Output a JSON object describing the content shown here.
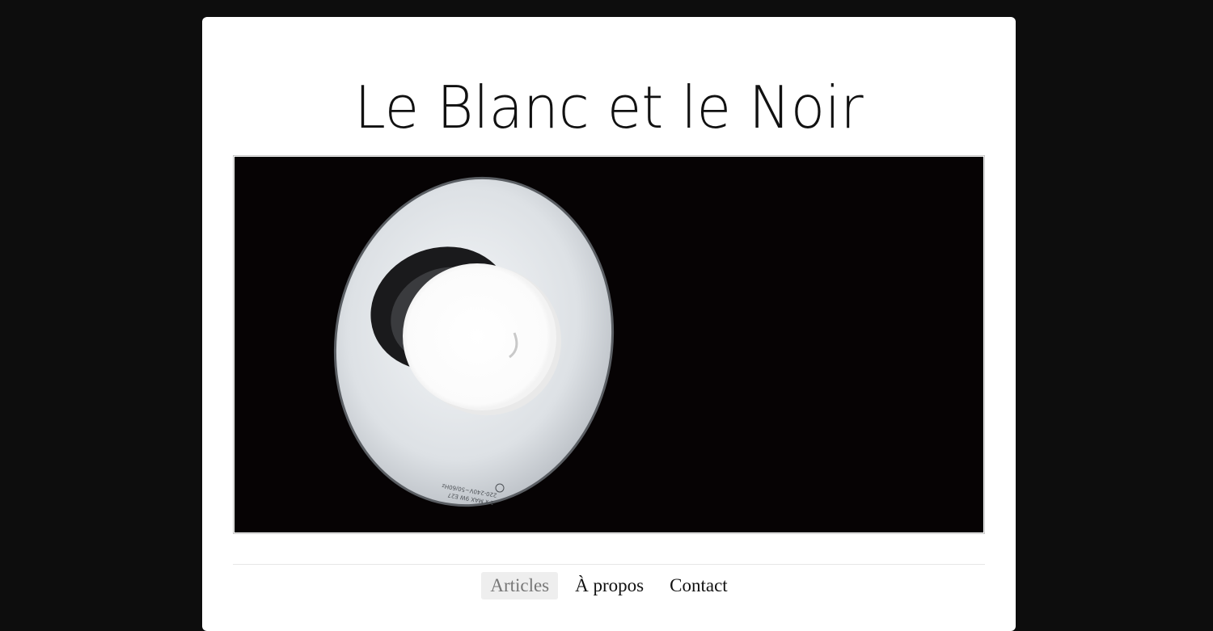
{
  "site": {
    "title": "Le Blanc et le Noir"
  },
  "banner": {
    "description_icon": "light-bulb-photo",
    "bulb_print_line1": "1 x MAX 9W E27",
    "bulb_print_line2": "220-240V~50/60Hz"
  },
  "nav": {
    "items": [
      {
        "label": "Articles",
        "active": true
      },
      {
        "label": "À propos",
        "active": false
      },
      {
        "label": "Contact",
        "active": false
      }
    ]
  },
  "colors": {
    "background": "#0d0d0d",
    "card": "#ffffff",
    "title": "#111111",
    "nav_active_bg": "#eeeeee",
    "nav_active_text": "#777777"
  }
}
